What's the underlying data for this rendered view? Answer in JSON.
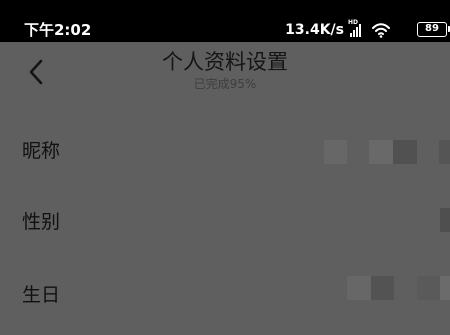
{
  "status_bar": {
    "time": "下午2:02",
    "network_speed": "13.4K/s",
    "signal_label": "HD",
    "signal_icon": "signal-icon",
    "wifi_icon": "wifi-icon",
    "battery_level": "89"
  },
  "header": {
    "back_icon": "chevron-left-icon",
    "title": "个人资料设置",
    "subtitle": "已完成95%"
  },
  "profile_fields": [
    {
      "label": "昵称",
      "value_visible": false
    },
    {
      "label": "性别",
      "value_visible": false
    },
    {
      "label": "生日",
      "value_visible": false
    }
  ],
  "colors": {
    "overlay": "#5f5f5f",
    "status_bar": "#000000",
    "text_primary": "#111111",
    "text_secondary": "#3e3e3e",
    "mask_light": "#676767",
    "mask_dark": "#4f4f4f"
  }
}
